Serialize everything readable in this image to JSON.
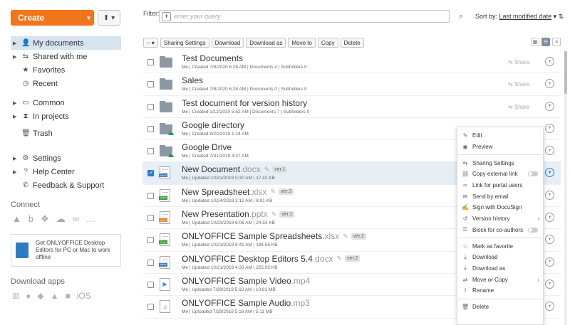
{
  "sidebar": {
    "create_label": "Create",
    "nav": [
      {
        "label": "My documents",
        "icon": "person-icon",
        "arrow": true,
        "active": true
      },
      {
        "label": "Shared with me",
        "icon": "share-icon",
        "arrow": true
      },
      {
        "label": "Favorites",
        "icon": "star-icon",
        "arrow": false
      },
      {
        "label": "Recent",
        "icon": "clock-icon",
        "arrow": false
      },
      {
        "label": "Common",
        "icon": "briefcase-icon",
        "arrow": true
      },
      {
        "label": "In projects",
        "icon": "projects-icon",
        "arrow": true
      },
      {
        "label": "Trash",
        "icon": "trash-icon",
        "arrow": false
      },
      {
        "label": "Settings",
        "icon": "gear-icon",
        "arrow": true
      },
      {
        "label": "Help Center",
        "icon": "question-icon",
        "arrow": true
      },
      {
        "label": "Feedback & Support",
        "icon": "megaphone-icon",
        "arrow": false
      }
    ],
    "connect_title": "Connect",
    "promo_text": "Get ONLYOFFICE Desktop Editors for PC or Mac to work offline",
    "download_title": "Download apps",
    "ios_label": "iOS"
  },
  "main": {
    "filter_label": "Filter:",
    "filter_placeholder": "enter your query",
    "sort_label": "Sort by:",
    "sort_value": "Last modified date",
    "toolbar": [
      "Sharing Settings",
      "Download",
      "Download as",
      "Move to",
      "Copy",
      "Delete"
    ],
    "share_label": "Share",
    "files": [
      {
        "name": "Test Documents",
        "ext": "",
        "type": "folder",
        "meta": "Me | Created 7/8/2020 6:28 AM | Documents 4 | Subfolders 0",
        "share": true
      },
      {
        "name": "Sales",
        "ext": "",
        "type": "folder",
        "meta": "Me | Created 7/8/2020 6:28 AM | Documents 0 | Subfolders 0",
        "share": true
      },
      {
        "name": "Test document for version history",
        "ext": "",
        "type": "folder",
        "meta": "Me | Created 1/12/2020 5:52 AM | Documents 7 | Subfolders 0",
        "share": true
      },
      {
        "name": "Google directory",
        "ext": "",
        "type": "gfolder",
        "meta": "Me | Created 8/20/2019 1:24 AM",
        "share": false
      },
      {
        "name": "Google Drive",
        "ext": "",
        "type": "gfolder",
        "meta": "Me | Created 7/31/2019 4:37 AM",
        "share": false
      },
      {
        "name": "New Document",
        "ext": ".docx",
        "type": "docx",
        "ver": "ver.1",
        "meta": "Me | Updated 10/31/2019 5:30 AM | 17.42 KB",
        "share": false,
        "selected": true
      },
      {
        "name": "New Spreadsheet",
        "ext": ".xlsx",
        "type": "xlsx",
        "ver": "ver.3",
        "meta": "Me | Updated 10/24/2019 3:12 AM | 8.91 KB",
        "share": false
      },
      {
        "name": "New Presentation",
        "ext": ".pptx",
        "type": "pptx",
        "ver": "ver.1",
        "meta": "Me | Updated 10/23/2019 6:06 AM | 24.53 KB",
        "share": false
      },
      {
        "name": "ONLYOFFICE Sample Spreadsheets",
        "ext": ".xlsx",
        "type": "xlsx",
        "ver": "ver.2",
        "meta": "Me | Updated 10/21/2019 8:42 AM | 194.55 KB",
        "share": false
      },
      {
        "name": "ONLYOFFICE Desktop Editors 5.4",
        "ext": ".docx",
        "type": "docx",
        "ver": "ver.2",
        "meta": "Me | Updated 10/21/2019 4:33 AM | 225.02 KB",
        "share": false
      },
      {
        "name": "ONLYOFFICE Sample Video",
        "ext": ".mp4",
        "type": "mp4",
        "meta": "Me | Uploaded 7/29/2019 5:18 AM | 10.81 MB",
        "share": false
      },
      {
        "name": "ONLYOFFICE Sample Audio",
        "ext": ".mp3",
        "type": "mp3",
        "meta": "Me | Uploaded 7/29/2019 5:18 AM | 5.11 MB",
        "share": false
      }
    ]
  },
  "context_menu": {
    "items": [
      {
        "label": "Edit",
        "icon": "pencil-icon"
      },
      {
        "label": "Preview",
        "icon": "eye-icon"
      },
      {
        "sep": true
      },
      {
        "label": "Sharing Settings",
        "icon": "sharing-icon"
      },
      {
        "label": "Copy external link",
        "icon": "link-icon",
        "toggle": true
      },
      {
        "label": "Link for portal users",
        "icon": "chain-icon"
      },
      {
        "label": "Send by email",
        "icon": "email-icon"
      },
      {
        "label": "Sign with DocuSign",
        "icon": "signature-icon"
      },
      {
        "label": "Version history",
        "icon": "history-icon",
        "submenu": true
      },
      {
        "label": "Block for co-authors",
        "icon": "lock-icon",
        "toggle": true
      },
      {
        "sep": true
      },
      {
        "label": "Mark as favorite",
        "icon": "star-outline-icon"
      },
      {
        "label": "Download",
        "icon": "download-icon"
      },
      {
        "label": "Download as",
        "icon": "download-as-icon"
      },
      {
        "label": "Move or Copy",
        "icon": "move-icon",
        "submenu": true
      },
      {
        "label": "Rename",
        "icon": "rename-icon"
      },
      {
        "sep": true
      },
      {
        "label": "Delete",
        "icon": "delete-icon"
      }
    ]
  },
  "colors": {
    "accent": "#f2751b",
    "selection": "#e6eef6",
    "docx": "#3f7fc4",
    "xlsx": "#3aa53a",
    "pptx": "#e08a28"
  }
}
